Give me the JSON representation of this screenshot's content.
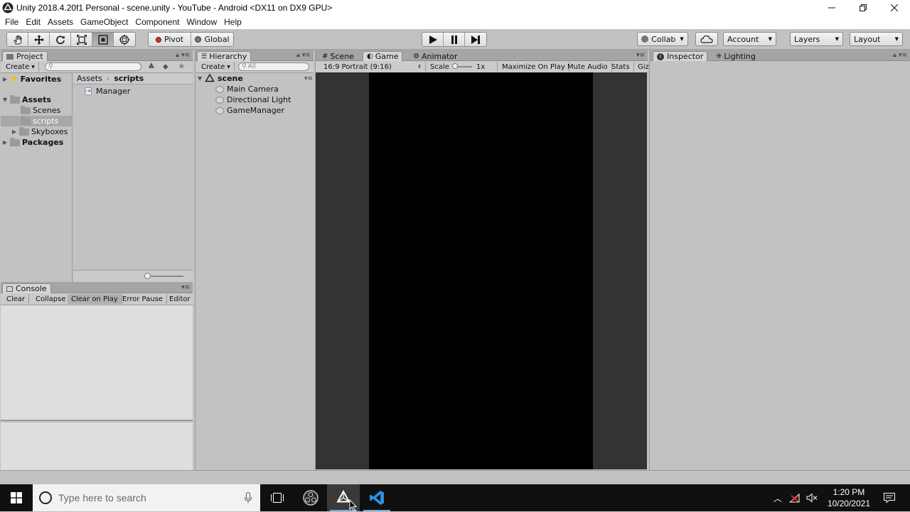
{
  "window": {
    "title": "Unity 2018.4.20f1 Personal - scene.unity - YouTube - Android <DX11 on DX9 GPU>"
  },
  "menu": [
    "File",
    "Edit",
    "Assets",
    "GameObject",
    "Component",
    "Window",
    "Help"
  ],
  "toolbar": {
    "pivot_label": "Pivot",
    "global_label": "Global",
    "collab_label": "Collab",
    "account_label": "Account",
    "layers_label": "Layers",
    "layout_label": "Layout"
  },
  "project": {
    "tab_label": "Project",
    "create_label": "Create",
    "favorites_label": "Favorites",
    "assets_label": "Assets",
    "folders": [
      "Scenes",
      "scripts",
      "Skyboxes"
    ],
    "packages_label": "Packages",
    "breadcrumb": {
      "root": "Assets",
      "current": "scripts"
    },
    "files": [
      "Manager"
    ]
  },
  "console": {
    "tab_label": "Console",
    "buttons": [
      "Clear",
      "Collapse",
      "Clear on Play",
      "Error Pause",
      "Editor"
    ]
  },
  "hierarchy": {
    "tab_label": "Hierarchy",
    "create_label": "Create",
    "search_placeholder": "All",
    "scene_name": "scene",
    "objects": [
      "Main Camera",
      "Directional Light",
      "GameManager"
    ]
  },
  "center_tabs": [
    "Scene",
    "Game",
    "Animator"
  ],
  "game": {
    "aspect_label": "16:9 Portrait (9:16)",
    "scale_label": "Scale",
    "scale_value": "1x",
    "maximize_label": "Maximize On Play",
    "mute_label": "Mute Audio",
    "stats_label": "Stats",
    "gizmos_label": "Giz"
  },
  "right_tabs": [
    "Inspector",
    "Lighting"
  ],
  "taskbar": {
    "search_placeholder": "Type here to search",
    "time": "1:20 PM",
    "date": "10/20/2021"
  }
}
